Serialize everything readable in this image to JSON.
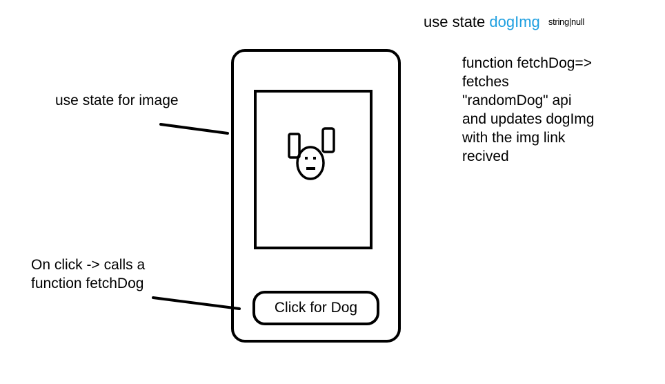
{
  "state_note": {
    "prefix": "use state",
    "variable": "dogImg",
    "type": "string|null"
  },
  "function_note": {
    "lines": [
      "function fetchDog=>",
      "fetches",
      "\"randomDog\" api",
      "and updates dogImg",
      "with the img link",
      "recived"
    ]
  },
  "image_note": {
    "text": "use state for image"
  },
  "click_note": {
    "lines": [
      "On click -> calls a",
      "function fetchDog"
    ]
  },
  "phone": {
    "image_placeholder_icon": "dog-face-icon",
    "button_label": "Click for Dog"
  },
  "colors": {
    "stroke": "#000000",
    "variable_accent": "#1e9fe0",
    "background": "#ffffff"
  }
}
